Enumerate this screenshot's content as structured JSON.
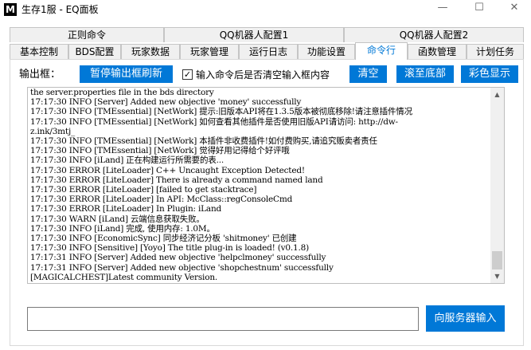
{
  "window": {
    "icon_letter": "M",
    "title": "生存1服 - EQ面板",
    "minimize": "—",
    "maximize": "☐",
    "close": "✕"
  },
  "tabs_row1": [
    "正则命令",
    "QQ机器人配置1",
    "QQ机器人配置2"
  ],
  "tabs_row2": [
    "基本控制",
    "BDS配置",
    "玩家数据",
    "玩家管理",
    "运行日志",
    "功能设置",
    "命令行",
    "函数管理",
    "计划任务"
  ],
  "active_tab": "命令行",
  "output": {
    "label": "输出框：",
    "pause_button": "暂停输出框刷新",
    "clear_on_enter_checked": true,
    "clear_on_enter_label": "输入命令后是否清空输入框内容",
    "clear_button": "清空",
    "scroll_bottom_button": "滚至底部",
    "color_button": "彩色显示"
  },
  "console_lines": [
    "the server.properties file in the bds directory",
    "17:17:30 INFO [Server] Added new objective 'money' successfully",
    "17:17:30 INFO [TMEssential] [NetWork] 提示:旧版本API将在1.3.5版本被彻底移除!请注意插件情况",
    "17:17:30 INFO [TMEssential] [NetWork] 如何查看其他插件是否使用旧版API请访问: http://dw-",
    "z.ink/3mtj_",
    "17:17:30 INFO [TMEssential] [NetWork] 本插件非收费插件!如付费购买,请追究贩卖者责任",
    "17:17:30 INFO [TMEssential] [NetWork] 觉得好用记得给个好评哦",
    "17:17:30 INFO [iLand] 正在构建运行所需要的表...",
    "17:17:30 ERROR [LiteLoader] C++ Uncaught Exception Detected!",
    "17:17:30 ERROR [LiteLoader] There is already a command named land",
    "17:17:30 ERROR [LiteLoader] [failed to get stacktrace]",
    "17:17:30 ERROR [LiteLoader] In API: McClass::regConsoleCmd",
    "17:17:30 ERROR [LiteLoader] In Plugin: iLand",
    "17:17:30 WARN [iLand] 云端信息获取失败。",
    "17:17:30 INFO [iLand] 完成, 使用内存: 1.0M。",
    "17:17:30 INFO [EconomicSync] 同步经济记分板 'shitmoney' 已创建",
    "17:17:30 INFO [Sensitive] [Yoyo] The title plug-in is loaded! (v0.1.8)",
    "17:17:31 INFO [Server] Added new objective 'helpclmoney' successfully",
    "17:17:31 INFO [Server] Added new objective 'shopchestnum' successfully",
    "[MAGICALCHEST]Latest community Version."
  ],
  "command": {
    "input_value": "",
    "send_button": "向服务器输入"
  },
  "colors": {
    "accent": "#0078d7",
    "tab_bg": "#f0f0f0"
  }
}
